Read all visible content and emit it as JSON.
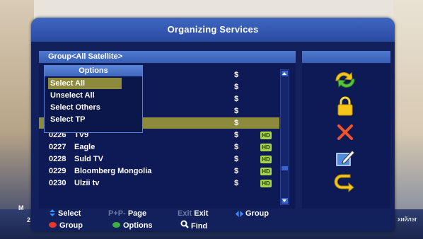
{
  "window": {
    "title": "Organizing Services"
  },
  "group_bar": {
    "label": "Group<All Satellite>"
  },
  "options_menu": {
    "title": "Options",
    "items": [
      {
        "label": "Select All",
        "highlighted": true
      },
      {
        "label": "Unselect All",
        "highlighted": false
      },
      {
        "label": "Select Others",
        "highlighted": false
      },
      {
        "label": "Select TP",
        "highlighted": false
      }
    ]
  },
  "channels": [
    {
      "num": "",
      "name": "",
      "scrambled": "$",
      "hd": ""
    },
    {
      "num": "",
      "name": "",
      "scrambled": "$",
      "hd": ""
    },
    {
      "num": "",
      "name": "",
      "scrambled": "$",
      "hd": ""
    },
    {
      "num": "",
      "name": "",
      "scrambled": "$",
      "hd": ""
    },
    {
      "num": "",
      "name": "",
      "scrambled": "$",
      "hd": "",
      "selected": true
    },
    {
      "num": "0226",
      "name": "TV9",
      "scrambled": "$",
      "hd": "HD"
    },
    {
      "num": "0227",
      "name": "Eagle",
      "scrambled": "$",
      "hd": "HD"
    },
    {
      "num": "0228",
      "name": "Suld TV",
      "scrambled": "$",
      "hd": "HD"
    },
    {
      "num": "0229",
      "name": "Bloomberg Mongolia",
      "scrambled": "$",
      "hd": "HD"
    },
    {
      "num": "0230",
      "name": "Ulzii tv",
      "scrambled": "$",
      "hd": "HD"
    }
  ],
  "side_icons": [
    "move-icon",
    "lock-icon",
    "delete-icon",
    "rename-icon",
    "skip-icon"
  ],
  "footer": {
    "row1": {
      "select": "Select",
      "page_key": "P+P-",
      "page": "Page",
      "exit_key": "Exit",
      "exit": "Exit",
      "group": "Group"
    },
    "row2": {
      "group": "Group",
      "options": "Options",
      "find": "Find"
    }
  },
  "background_text": {
    "left1": "M",
    "left2": "2",
    "right": "хийлэг"
  },
  "colors": {
    "panel_bg": "#0e1a56",
    "title_bar": "#3f67c0",
    "highlight": "#8d8a3c",
    "hd_badge": "#a7d447",
    "red_key": "#e53a2a",
    "green_key": "#3cb043"
  }
}
